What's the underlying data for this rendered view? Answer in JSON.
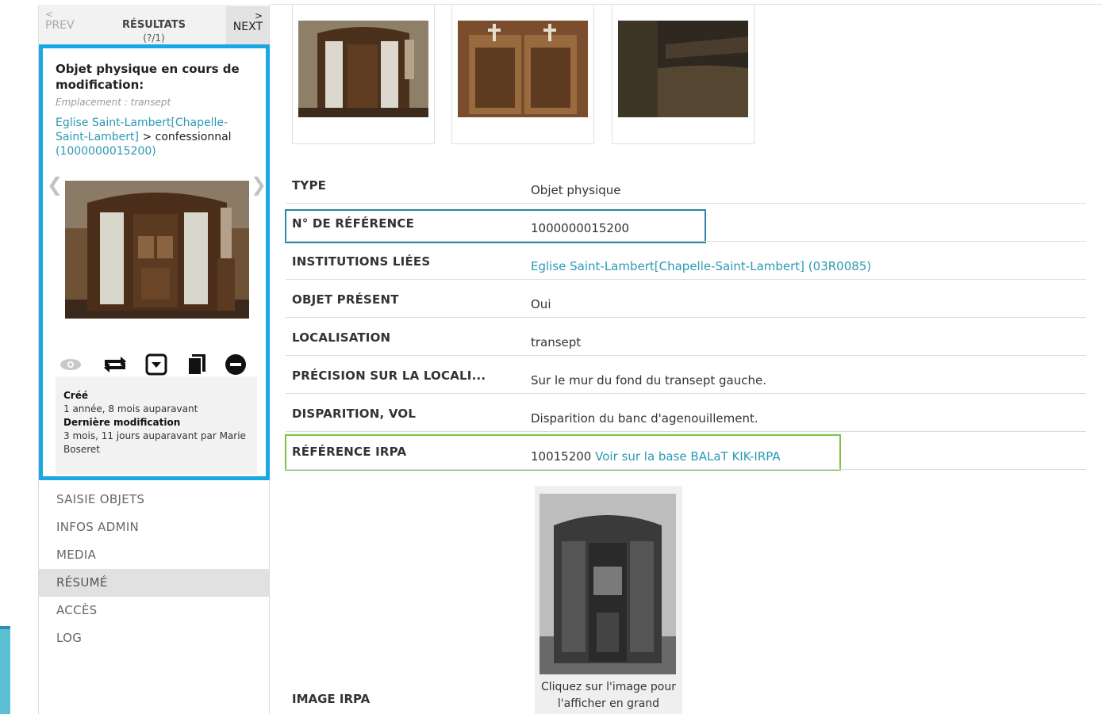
{
  "nav": {
    "prev": "PREV",
    "results": "RÉSULTATS",
    "results_count": "(?/1)",
    "next": "NEXT"
  },
  "card": {
    "title": "Objet physique en cours de modification:",
    "location": "Emplacement : transept",
    "path_link": "Eglise Saint-Lambert[Chapelle-Saint-Lambert]",
    "path_sep": " > confessionnal ",
    "path_id": "(1000000015200)",
    "created_label": "Créé",
    "created_value": "1 année, 8 mois auparavant",
    "modified_label": "Dernière modification",
    "modified_value": "3 mois, 11 jours auparavant par Marie Boseret"
  },
  "actions": [
    "eye-icon",
    "repeat-icon",
    "dropdown-box-icon",
    "copy-icon",
    "remove-icon"
  ],
  "menu": [
    "SAISIE OBJETS",
    "INFOS ADMIN",
    "MEDIA",
    "RÉSUMÉ",
    "ACCÈS",
    "LOG"
  ],
  "menu_active": "RÉSUMÉ",
  "details": [
    {
      "label": "TYPE",
      "value": "Objet physique"
    },
    {
      "label": "N° DE RÉFÉRENCE",
      "value": "1000000015200"
    },
    {
      "label": "INSTITUTIONS LIÉES",
      "value": "Eglise Saint-Lambert[Chapelle-Saint-Lambert] (03R0085)"
    },
    {
      "label": "OBJET PRÉSENT",
      "value": "Oui"
    },
    {
      "label": "LOCALISATION",
      "value": "transept"
    },
    {
      "label": "PRÉCISION SUR LA LOCALI...",
      "value": "Sur le mur du fond du transept gauche."
    },
    {
      "label": "DISPARITION, VOL",
      "value": "Disparition du banc d'agenouillement."
    },
    {
      "label": "RÉFÉRENCE IRPA",
      "value": "10015200",
      "link": "Voir sur la base BALaT KIK-IRPA"
    }
  ],
  "irpa": {
    "label": "IMAGE IRPA",
    "caption": "Cliquez sur l'image pour l'afficher en grand"
  },
  "colors": {
    "accent": "#1aa7e4",
    "link": "#2a9ab3",
    "highlight_blue": "#2b85aa",
    "highlight_green": "#7dc242"
  }
}
